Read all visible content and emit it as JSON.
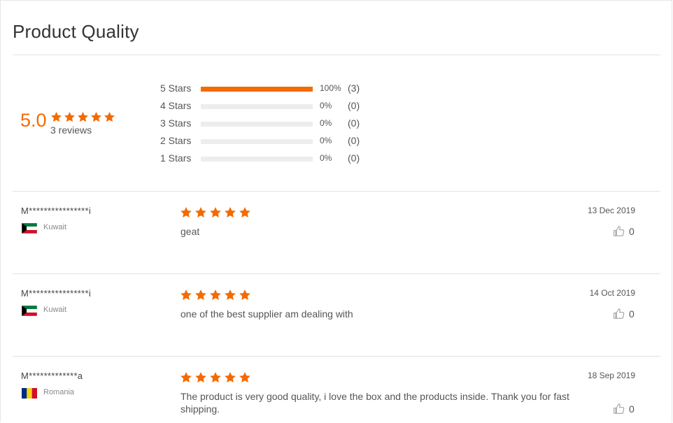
{
  "section_title": "Product Quality",
  "colors": {
    "accent": "#f56a00",
    "track": "#ededed",
    "divider": "#e3e3e3"
  },
  "summary": {
    "score": "5.0",
    "stars": 5,
    "review_count": "3 reviews",
    "distribution": [
      {
        "label": "5  Stars",
        "fraction": 1.0,
        "percent": "100%",
        "count": "(3)"
      },
      {
        "label": "4  Stars",
        "fraction": 0.0,
        "percent": "0%",
        "count": "(0)"
      },
      {
        "label": "3  Stars",
        "fraction": 0.0,
        "percent": "0%",
        "count": "(0)"
      },
      {
        "label": "2  Stars",
        "fraction": 0.0,
        "percent": "0%",
        "count": "(0)"
      },
      {
        "label": "1  Stars",
        "fraction": 0.0,
        "percent": "0%",
        "count": "(0)"
      }
    ]
  },
  "reviews": [
    {
      "name": "M****************i",
      "flag_icon": "kuwait-flag-icon",
      "country": "Kuwait",
      "stars": 5,
      "text": "geat",
      "date": "13 Dec 2019",
      "likes": "0"
    },
    {
      "name": "M****************i",
      "flag_icon": "kuwait-flag-icon",
      "country": "Kuwait",
      "stars": 5,
      "text": "one of the best supplier am dealing with",
      "date": "14 Oct 2019",
      "likes": "0"
    },
    {
      "name": "M*************a",
      "flag_icon": "romania-flag-icon",
      "country": "Romania",
      "stars": 5,
      "text": "The product is very good quality, i love the box and the products inside. Thank you for fast shipping.",
      "date": "18 Sep 2019",
      "likes": "0"
    }
  ]
}
